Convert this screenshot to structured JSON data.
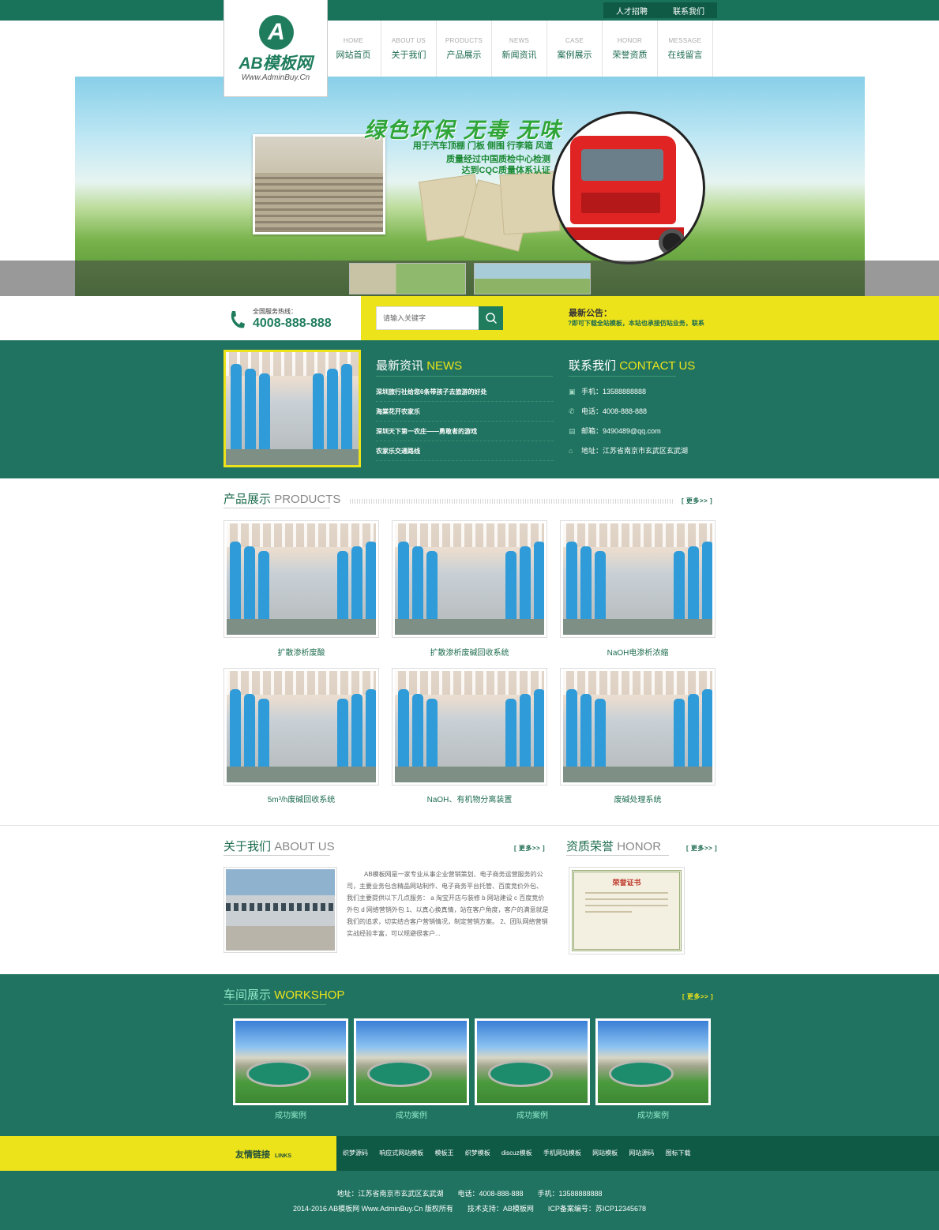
{
  "topbar": {
    "links": [
      "人才招聘",
      "联系我们"
    ]
  },
  "logo": {
    "letter": "A",
    "name": "AB模板网",
    "url": "Www.AdminBuy.Cn"
  },
  "nav": [
    {
      "en": "HOME",
      "cn": "网站首页"
    },
    {
      "en": "ABOUT US",
      "cn": "关于我们"
    },
    {
      "en": "PRODUCTS",
      "cn": "产品展示"
    },
    {
      "en": "NEWS",
      "cn": "新闻资讯"
    },
    {
      "en": "CASE",
      "cn": "案例展示"
    },
    {
      "en": "HONOR",
      "cn": "荣誉资质"
    },
    {
      "en": "MESSAGE",
      "cn": "在线留言"
    }
  ],
  "banner": {
    "slogan": "绿色环保 无毒 无味",
    "lines": [
      "用于汽车顶棚 门板 侧围 行李箱 风道",
      "质量经过中国质检中心检测",
      "达到CQC质量体系认证"
    ]
  },
  "info": {
    "hotline_label": "全国服务热线：",
    "hotline": "4008-888-888",
    "search_placeholder": "请输入关键字",
    "notice_title": "最新公告：",
    "notice_text": "?即可下载全站模板，本站也承接仿站业务，联系"
  },
  "news": {
    "title_cn": "最新资讯",
    "title_en": "NEWS",
    "items": [
      "深圳旅行社给您6条带孩子去旅游的好处",
      "海棠花开农家乐",
      "深圳天下第一农庄——勇敢者的游戏",
      "农家乐交通路线"
    ]
  },
  "contact": {
    "title_cn": "联系我们",
    "title_en": "CONTACT US",
    "items": [
      "手机：13588888888",
      "电话：4008-888-888",
      "邮箱：9490489@qq.com",
      "地址：江苏省南京市玄武区玄武湖"
    ]
  },
  "products": {
    "title_cn": "产品展示",
    "title_en": "PRODUCTS",
    "more": "[ 更多>> ]",
    "items": [
      "扩散渗析废酸",
      "扩散渗析废碱回收系统",
      "NaOH电渗析浓缩",
      "5m³/h废碱回收系统",
      "NaOH、有机物分离装置",
      "废碱处理系统"
    ]
  },
  "about": {
    "title_cn": "关于我们",
    "title_en": "ABOUT US",
    "more": "[ 更多>> ]",
    "text": "AB模板网是一家专业从事企业营销策划、电子商务运营服务的公司，主要业务包含精品网站制作、电子商务平台托管、百度竞价外包、 我们主要提供以下几点服务： a 淘宝开店与装修 b 网站建设 c 百度竞价外包 d 网络营销外包 1、以真心换真情，站在客户角度，客户的满意就是我们的追求，切实结合客户营销情况，制定营销方案。 2、团队网络营销实战经验丰富，可以规避很客户..."
  },
  "honor": {
    "title_cn": "资质荣誉",
    "title_en": "HONOR",
    "more": "[ 更多>> ]",
    "cert_title": "荣誉证书"
  },
  "workshop": {
    "title_cn": "车间展示",
    "title_en": "WORKSHOP",
    "more": "[ 更多>> ]",
    "items": [
      "成功案例",
      "成功案例",
      "成功案例",
      "成功案例"
    ]
  },
  "links": {
    "label": "友情链接",
    "label_en": "LINKS",
    "items": [
      "织梦源码",
      "响应式网站模板",
      "模板王",
      "织梦模板",
      "discuz模板",
      "手机网站模板",
      "网站模板",
      "网站源码",
      "图标下载"
    ]
  },
  "footer": {
    "line1": "地址：江苏省南京市玄武区玄武湖　　电话：4008-888-888　　手机：13588888888",
    "line2": "2014-2016 AB模板网 Www.AdminBuy.Cn 版权所有　　技术支持：AB模板网　　ICP备案编号：苏ICP12345678"
  },
  "colors": {
    "primary": "#1f7360",
    "accent": "#ede31b",
    "dark": "#0f5a45"
  }
}
